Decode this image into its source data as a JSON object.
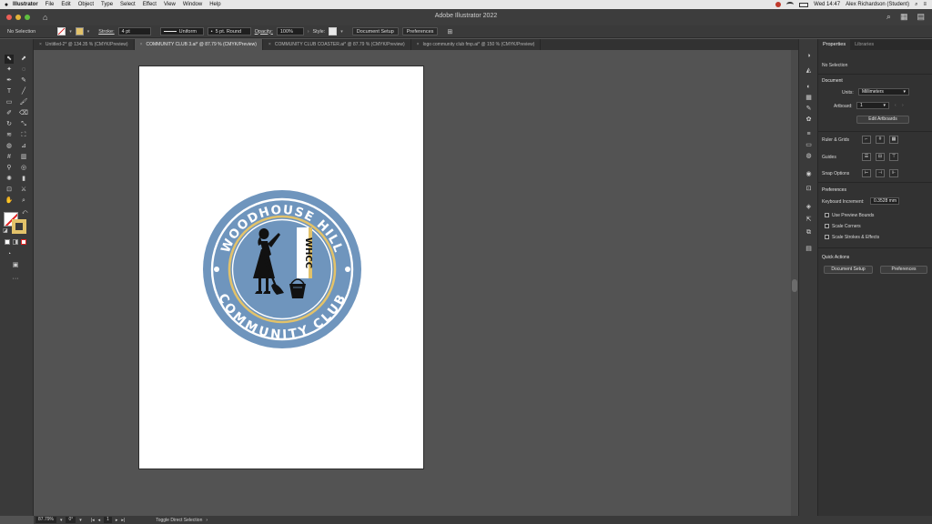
{
  "menubar": {
    "app": "Illustrator",
    "items": [
      "File",
      "Edit",
      "Object",
      "Type",
      "Select",
      "Effect",
      "View",
      "Window",
      "Help"
    ],
    "clock": "Wed 14:47",
    "user": "Alex Richardson (Student)"
  },
  "titlebar": {
    "title": "Adobe Illustrator 2022"
  },
  "controlbar": {
    "selection": "No Selection",
    "stroke_label": "Stroke:",
    "stroke_value": "4 pt",
    "profile": "Uniform",
    "brush": "5 pt. Round",
    "opacity_label": "Opacity:",
    "opacity_value": "100%",
    "style_label": "Style:",
    "document_setup": "Document Setup",
    "preferences": "Preferences"
  },
  "tabs": [
    {
      "label": "Untitled-2* @ 134.35 % (CMYK/Preview)",
      "active": false
    },
    {
      "label": "COMMUNITY CLUB 3.ai* @ 87.79 % (CMYK/Preview)",
      "active": true
    },
    {
      "label": "COMMUNITY CLUB COASTER.ai* @ 87.79 % (CMYK/Preview)",
      "active": false
    },
    {
      "label": "logo community club fmp.ai* @ 150 % (CMYK/Preview)",
      "active": false
    }
  ],
  "logo": {
    "top_text": "WOODHOUSE HILL",
    "bottom_text": "COMMUNITY CLUB",
    "monogram": "WHCC",
    "colors": {
      "outer": "#6f95bd",
      "ring": "#e2c26a",
      "inner": "#6f95bd",
      "text": "#ffffff",
      "silhouette": "#111111"
    }
  },
  "panel": {
    "tabs": [
      "Properties",
      "Libraries"
    ],
    "no_selection": "No Selection",
    "document": "Document",
    "units_label": "Units:",
    "units_value": "Millimeters",
    "artboard_label": "Artboard:",
    "artboard_value": "1",
    "edit_artboards": "Edit Artboards",
    "ruler_grids": "Ruler & Grids",
    "guides": "Guides",
    "snap_options": "Snap Options",
    "preferences": "Preferences",
    "keyboard_increment_label": "Keyboard Increment:",
    "keyboard_increment_value": "0.3528 mm",
    "use_preview_bounds": "Use Preview Bounds",
    "scale_corners": "Scale Corners",
    "scale_strokes": "Scale Strokes & Effects",
    "quick_actions": "Quick Actions",
    "qa_document_setup": "Document Setup",
    "qa_preferences": "Preferences"
  },
  "statusbar": {
    "zoom": "87.79%",
    "rotation": "0°",
    "artboard": "1",
    "tool": "Toggle Direct Selection"
  }
}
